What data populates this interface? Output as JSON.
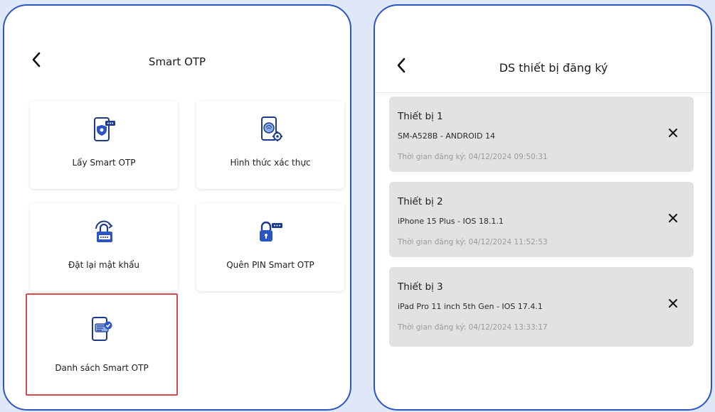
{
  "left": {
    "title": "Smart OTP",
    "tiles": [
      {
        "label": "Lấy Smart OTP",
        "icon": "phone-shield-icon"
      },
      {
        "label": "Hình thức xác thực",
        "icon": "phone-fingerprint-gear-icon"
      },
      {
        "label": "Đặt lại mật khẩu",
        "icon": "lock-refresh-icon"
      },
      {
        "label": "Quên PIN Smart OTP",
        "icon": "lock-pin-icon"
      },
      {
        "label": "Danh sách Smart OTP",
        "icon": "phone-list-check-icon"
      }
    ]
  },
  "right": {
    "title": "DS thiết bị đăng ký",
    "devices": [
      {
        "name": "Thiết bị 1",
        "model": "SM-A528B - ANDROID 14",
        "registered": "Thời gian đăng ký: 04/12/2024 09:50:31"
      },
      {
        "name": "Thiết bị 2",
        "model": "iPhone 15 Plus - IOS 18.1.1",
        "registered": "Thời gian đăng ký: 04/12/2024 11:52:53"
      },
      {
        "name": "Thiết bị 3",
        "model": "iPad Pro 11 inch 5th Gen - IOS 17.4.1",
        "registered": "Thời gian đăng ký: 04/12/2024 13:33:17"
      }
    ]
  },
  "colors": {
    "accent": "#2b55c7",
    "background": "#dfe8f9",
    "card": "#e2e2e2",
    "highlight": "#d84a4a"
  }
}
